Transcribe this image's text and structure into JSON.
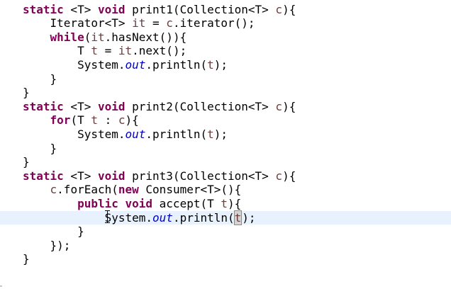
{
  "editor": {
    "lines": [
      [
        {
          "c": "kw",
          "t": "static"
        },
        {
          "c": "txt",
          "t": " <T> "
        },
        {
          "c": "kw",
          "t": "void"
        },
        {
          "c": "txt",
          "t": " print1(Collection<T> "
        },
        {
          "c": "param",
          "t": "c"
        },
        {
          "c": "txt",
          "t": "){"
        }
      ],
      [
        {
          "c": "txt",
          "t": "    Iterator<T> "
        },
        {
          "c": "var",
          "t": "it"
        },
        {
          "c": "txt",
          "t": " = "
        },
        {
          "c": "param",
          "t": "c"
        },
        {
          "c": "txt",
          "t": ".iterator();"
        }
      ],
      [
        {
          "c": "txt",
          "t": "    "
        },
        {
          "c": "kw",
          "t": "while"
        },
        {
          "c": "txt",
          "t": "("
        },
        {
          "c": "var",
          "t": "it"
        },
        {
          "c": "txt",
          "t": ".hasNext()){"
        }
      ],
      [
        {
          "c": "txt",
          "t": "        T "
        },
        {
          "c": "var",
          "t": "t"
        },
        {
          "c": "txt",
          "t": " = "
        },
        {
          "c": "var",
          "t": "it"
        },
        {
          "c": "txt",
          "t": ".next();"
        }
      ],
      [
        {
          "c": "txt",
          "t": "        System."
        },
        {
          "c": "fld",
          "t": "out"
        },
        {
          "c": "txt",
          "t": ".println("
        },
        {
          "c": "var",
          "t": "t"
        },
        {
          "c": "txt",
          "t": ");"
        }
      ],
      [
        {
          "c": "txt",
          "t": "    }"
        }
      ],
      [
        {
          "c": "txt",
          "t": "}"
        }
      ],
      [
        {
          "c": "kw",
          "t": "static"
        },
        {
          "c": "txt",
          "t": " <T> "
        },
        {
          "c": "kw",
          "t": "void"
        },
        {
          "c": "txt",
          "t": " print2(Collection<T> "
        },
        {
          "c": "param",
          "t": "c"
        },
        {
          "c": "txt",
          "t": "){"
        }
      ],
      [
        {
          "c": "txt",
          "t": "    "
        },
        {
          "c": "kw",
          "t": "for"
        },
        {
          "c": "txt",
          "t": "(T "
        },
        {
          "c": "var",
          "t": "t"
        },
        {
          "c": "txt",
          "t": " : "
        },
        {
          "c": "param",
          "t": "c"
        },
        {
          "c": "txt",
          "t": "){"
        }
      ],
      [
        {
          "c": "txt",
          "t": "        System."
        },
        {
          "c": "fld",
          "t": "out"
        },
        {
          "c": "txt",
          "t": ".println("
        },
        {
          "c": "var",
          "t": "t"
        },
        {
          "c": "txt",
          "t": ");"
        }
      ],
      [
        {
          "c": "txt",
          "t": "    }"
        }
      ],
      [
        {
          "c": "txt",
          "t": "}"
        }
      ],
      [
        {
          "c": "kw",
          "t": "static"
        },
        {
          "c": "txt",
          "t": " <T> "
        },
        {
          "c": "kw",
          "t": "void"
        },
        {
          "c": "txt",
          "t": " print3(Collection<T> "
        },
        {
          "c": "param",
          "t": "c"
        },
        {
          "c": "txt",
          "t": "){"
        }
      ],
      [
        {
          "c": "txt",
          "t": "    "
        },
        {
          "c": "param",
          "t": "c"
        },
        {
          "c": "txt",
          "t": ".forEach("
        },
        {
          "c": "kw",
          "t": "new"
        },
        {
          "c": "txt",
          "t": " Consumer<T>(){"
        }
      ],
      [
        {
          "c": "txt",
          "t": "        "
        },
        {
          "c": "kw",
          "t": "public"
        },
        {
          "c": "txt",
          "t": " "
        },
        {
          "c": "kw",
          "t": "void"
        },
        {
          "c": "txt",
          "t": " accept(T "
        },
        {
          "c": "param",
          "t": "t"
        },
        {
          "c": "txt",
          "t": "){"
        }
      ],
      [
        {
          "c": "txt",
          "t": "            System."
        },
        {
          "c": "fld",
          "t": "out"
        },
        {
          "c": "txt",
          "t": ".println("
        },
        {
          "c": "param hl",
          "t": "t"
        },
        {
          "c": "caret",
          "t": ""
        },
        {
          "c": "txt",
          "t": ");"
        }
      ],
      [
        {
          "c": "txt",
          "t": "        }"
        }
      ],
      [
        {
          "c": "txt",
          "t": "    });"
        }
      ],
      [
        {
          "c": "txt",
          "t": "}"
        }
      ]
    ],
    "current_line_index": 15,
    "colors": {
      "keyword": "#7f0055",
      "static_field": "#0000c0",
      "local_variable": "#6a3e3e",
      "current_line": "#e8f2fe",
      "background": "#ffffff"
    }
  }
}
